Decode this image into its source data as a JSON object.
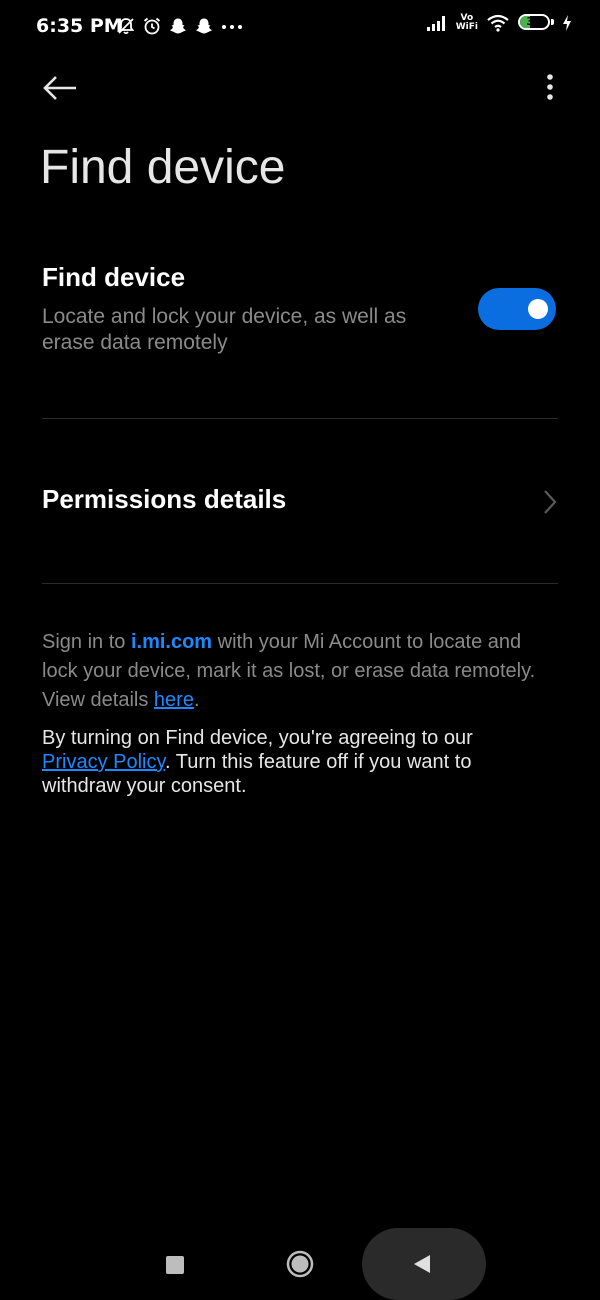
{
  "status_bar": {
    "time": "6:35 PM",
    "left_icons": [
      "bell-off-icon",
      "alarm-icon",
      "snapchat-icon",
      "snapchat-icon",
      "more-notifications-icon"
    ],
    "vowifi_top": "Vo",
    "vowifi_bottom": "WiFi",
    "battery_level": "35",
    "battery_fraction": 0.35,
    "battery_color": "#4caf50"
  },
  "app_bar": {
    "back_icon": "arrow-left-icon",
    "more_icon": "more-vertical-icon"
  },
  "page": {
    "title": "Find device"
  },
  "find_device_setting": {
    "title": "Find device",
    "description": "Locate and lock your device, as well as erase data remotely",
    "enabled": true,
    "toggle_color": "#0a6de0"
  },
  "permissions": {
    "title": "Permissions details"
  },
  "info": {
    "part1": "Sign in to ",
    "domain": "i.mi.com",
    "part2": " with your Mi Account to locate and lock your device, mark it as lost, or erase data remotely. View details ",
    "link": "here",
    "part3": "."
  },
  "consent": {
    "part1": "By turning on Find device, you're agreeing to our ",
    "link": "Privacy Policy",
    "part2": ". Turn this feature off if you want to withdraw your consent."
  },
  "nav_bar": {
    "icons": [
      "recents-icon",
      "home-icon",
      "back-triangle-icon"
    ]
  },
  "colors": {
    "background": "#000000",
    "accent": "#1e88ff",
    "secondary_text": "#8a8a8a"
  }
}
